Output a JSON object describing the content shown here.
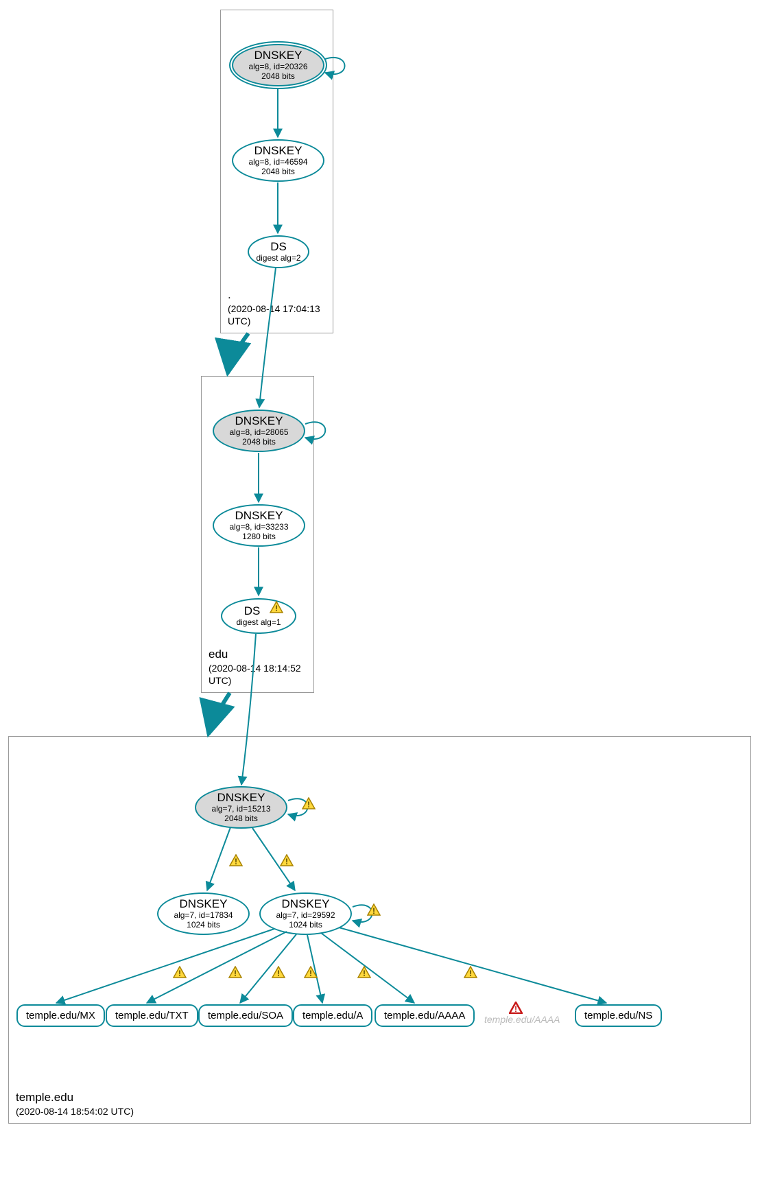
{
  "zones": {
    "root": {
      "name": ".",
      "timestamp": "(2020-08-14 17:04:13 UTC)"
    },
    "edu": {
      "name": "edu",
      "timestamp": "(2020-08-14 18:14:52 UTC)"
    },
    "temple": {
      "name": "temple.edu",
      "timestamp": "(2020-08-14 18:54:02 UTC)"
    }
  },
  "nodes": {
    "root_ksk": {
      "title": "DNSKEY",
      "meta1": "alg=8, id=20326",
      "meta2": "2048 bits"
    },
    "root_zsk": {
      "title": "DNSKEY",
      "meta1": "alg=8, id=46594",
      "meta2": "2048 bits"
    },
    "root_ds": {
      "title": "DS",
      "meta1": "digest alg=2"
    },
    "edu_ksk": {
      "title": "DNSKEY",
      "meta1": "alg=8, id=28065",
      "meta2": "2048 bits"
    },
    "edu_zsk": {
      "title": "DNSKEY",
      "meta1": "alg=8, id=33233",
      "meta2": "1280 bits"
    },
    "edu_ds": {
      "title": "DS",
      "meta1": "digest alg=1"
    },
    "temple_ksk": {
      "title": "DNSKEY",
      "meta1": "alg=7, id=15213",
      "meta2": "2048 bits"
    },
    "temple_zsk1": {
      "title": "DNSKEY",
      "meta1": "alg=7, id=17834",
      "meta2": "1024 bits"
    },
    "temple_zsk2": {
      "title": "DNSKEY",
      "meta1": "alg=7, id=29592",
      "meta2": "1024 bits"
    },
    "rr_mx": {
      "label": "temple.edu/MX"
    },
    "rr_txt": {
      "label": "temple.edu/TXT"
    },
    "rr_soa": {
      "label": "temple.edu/SOA"
    },
    "rr_a": {
      "label": "temple.edu/A"
    },
    "rr_aaaa": {
      "label": "temple.edu/AAAA"
    },
    "rr_aaaa_grey": {
      "label": "temple.edu/AAAA"
    },
    "rr_ns": {
      "label": "temple.edu/NS"
    }
  },
  "colors": {
    "teal": "#0c8a99",
    "warn_fill": "#ffd83d",
    "warn_stroke": "#a88200",
    "error_stroke": "#c71818"
  }
}
